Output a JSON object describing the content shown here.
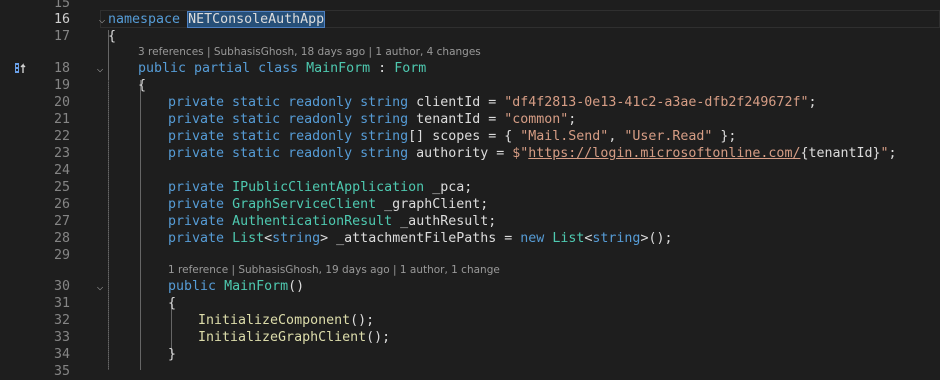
{
  "editor": {
    "lines": [
      {
        "n": "15",
        "code": []
      },
      {
        "n": "16",
        "code": [
          [
            "kw",
            "namespace"
          ],
          [
            "plain",
            " "
          ],
          [
            "ns",
            "NETConsoleAuthApp"
          ]
        ]
      },
      {
        "n": "17",
        "code": [
          [
            "plain",
            "{"
          ]
        ]
      },
      {
        "lens": "3 references | SubhasisGhosh, 18 days ago | 1 author, 4 changes"
      },
      {
        "n": "18",
        "code": [
          [
            "kw",
            "public partial class"
          ],
          [
            "plain",
            " "
          ],
          [
            "type",
            "MainForm"
          ],
          [
            "plain",
            " : "
          ],
          [
            "type",
            "Form"
          ]
        ]
      },
      {
        "n": "19",
        "code": [
          [
            "plain",
            "{"
          ]
        ]
      },
      {
        "n": "20",
        "code": [
          [
            "kw",
            "private static readonly string"
          ],
          [
            "plain",
            " clientId = "
          ],
          [
            "str",
            "\"df4f2813-0e13-41c2-a3ae-dfb2f249672f\""
          ],
          [
            "plain",
            ";"
          ]
        ]
      },
      {
        "n": "21",
        "code": [
          [
            "kw",
            "private static readonly string"
          ],
          [
            "plain",
            " tenantId = "
          ],
          [
            "str",
            "\"common\""
          ],
          [
            "plain",
            ";"
          ]
        ]
      },
      {
        "n": "22",
        "code": [
          [
            "kw",
            "private static readonly string"
          ],
          [
            "plain",
            "[] scopes = { "
          ],
          [
            "str",
            "\"Mail.Send\""
          ],
          [
            "plain",
            ", "
          ],
          [
            "str",
            "\"User.Read\""
          ],
          [
            "plain",
            " };"
          ]
        ]
      },
      {
        "n": "23",
        "code": [
          [
            "kw",
            "private static readonly string"
          ],
          [
            "plain",
            " authority = "
          ],
          [
            "str",
            "$\""
          ],
          [
            "link",
            "https://login.microsoftonline.com/"
          ],
          [
            "interp",
            "{tenantId}"
          ],
          [
            "str",
            "\""
          ],
          [
            "plain",
            ";"
          ]
        ]
      },
      {
        "n": "24",
        "code": []
      },
      {
        "n": "25",
        "code": [
          [
            "kw",
            "private"
          ],
          [
            "plain",
            " "
          ],
          [
            "type",
            "IPublicClientApplication"
          ],
          [
            "plain",
            " _pca;"
          ]
        ]
      },
      {
        "n": "26",
        "code": [
          [
            "kw",
            "private"
          ],
          [
            "plain",
            " "
          ],
          [
            "type",
            "GraphServiceClient"
          ],
          [
            "plain",
            " _graphClient;"
          ]
        ]
      },
      {
        "n": "27",
        "code": [
          [
            "kw",
            "private"
          ],
          [
            "plain",
            " "
          ],
          [
            "type",
            "AuthenticationResult"
          ],
          [
            "plain",
            " _authResult;"
          ]
        ]
      },
      {
        "n": "28",
        "code": [
          [
            "kw",
            "private"
          ],
          [
            "plain",
            " "
          ],
          [
            "type",
            "List"
          ],
          [
            "plain",
            "<"
          ],
          [
            "kw",
            "string"
          ],
          [
            "plain",
            "> _attachmentFilePaths = "
          ],
          [
            "kw",
            "new"
          ],
          [
            "plain",
            " "
          ],
          [
            "type",
            "List"
          ],
          [
            "plain",
            "<"
          ],
          [
            "kw",
            "string"
          ],
          [
            "plain",
            ">();"
          ]
        ]
      },
      {
        "n": "29",
        "code": []
      },
      {
        "lens": "1 reference | SubhasisGhosh, 19 days ago | 1 author, 1 change"
      },
      {
        "n": "30",
        "code": [
          [
            "kw",
            "public"
          ],
          [
            "plain",
            " "
          ],
          [
            "type",
            "MainForm"
          ],
          [
            "plain",
            "()"
          ]
        ]
      },
      {
        "n": "31",
        "code": [
          [
            "plain",
            "{"
          ]
        ]
      },
      {
        "n": "32",
        "code": [
          [
            "method",
            "InitializeComponent"
          ],
          [
            "plain",
            "();"
          ]
        ]
      },
      {
        "n": "33",
        "code": [
          [
            "method",
            "InitializeGraphClient"
          ],
          [
            "plain",
            "();"
          ]
        ]
      },
      {
        "n": "34",
        "code": [
          [
            "plain",
            "}"
          ]
        ]
      },
      {
        "n": "35",
        "code": []
      }
    ]
  },
  "gutter": {
    "marker_icon": "implements-override-icon",
    "marker_line": "18"
  }
}
